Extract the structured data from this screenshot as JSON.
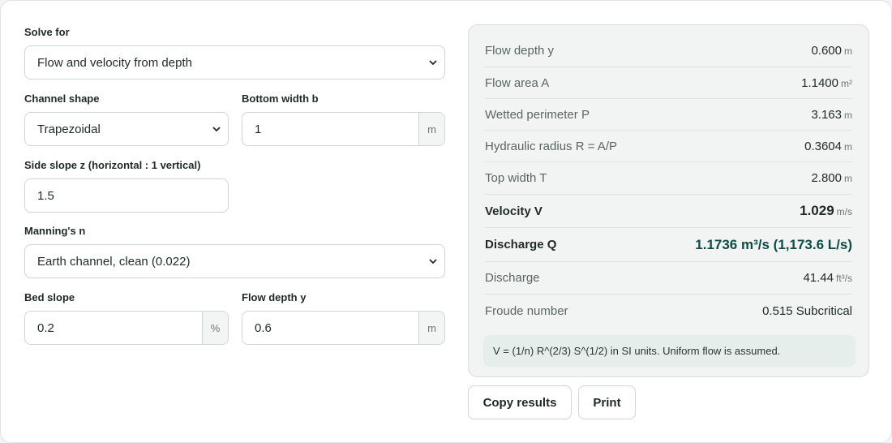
{
  "form": {
    "solve_for": {
      "label": "Solve for",
      "value": "Flow and velocity from depth"
    },
    "channel_shape": {
      "label": "Channel shape",
      "value": "Trapezoidal"
    },
    "bottom_width": {
      "label": "Bottom width b",
      "value": "1",
      "unit": "m"
    },
    "side_slope": {
      "label": "Side slope z (horizontal : 1 vertical)",
      "value": "1.5"
    },
    "mannings_n": {
      "label": "Manning's n",
      "value": "Earth channel, clean (0.022)"
    },
    "bed_slope": {
      "label": "Bed slope",
      "value": "0.2",
      "unit": "%"
    },
    "flow_depth": {
      "label": "Flow depth y",
      "value": "0.6",
      "unit": "m"
    }
  },
  "results": {
    "rows": [
      {
        "label": "Flow depth y",
        "value": "0.600",
        "unit": "m"
      },
      {
        "label": "Flow area A",
        "value": "1.1400",
        "unit": "m²"
      },
      {
        "label": "Wetted perimeter P",
        "value": "3.163",
        "unit": "m"
      },
      {
        "label": "Hydraulic radius R = A/P",
        "value": "0.3604",
        "unit": "m"
      },
      {
        "label": "Top width T",
        "value": "2.800",
        "unit": "m"
      },
      {
        "label": "Velocity V",
        "value": "1.029",
        "unit": "m/s"
      },
      {
        "label": "Discharge Q",
        "value": "1.1736 m³/s (1,173.6 L/s)",
        "unit": ""
      },
      {
        "label": "Discharge",
        "value": "41.44",
        "unit": "ft³/s"
      },
      {
        "label": "Froude number",
        "value": "0.515 Subcritical",
        "unit": ""
      }
    ],
    "note": "V = (1/n) R^(2/3) S^(1/2) in SI units. Uniform flow is assumed."
  },
  "actions": {
    "copy_label": "Copy results",
    "print_label": "Print"
  },
  "colors": {
    "accent": "#0f4c46",
    "panel_bg": "#f1f4f2",
    "border": "#cfd6d3"
  },
  "icons": {
    "select": "chevron-down-icon"
  }
}
